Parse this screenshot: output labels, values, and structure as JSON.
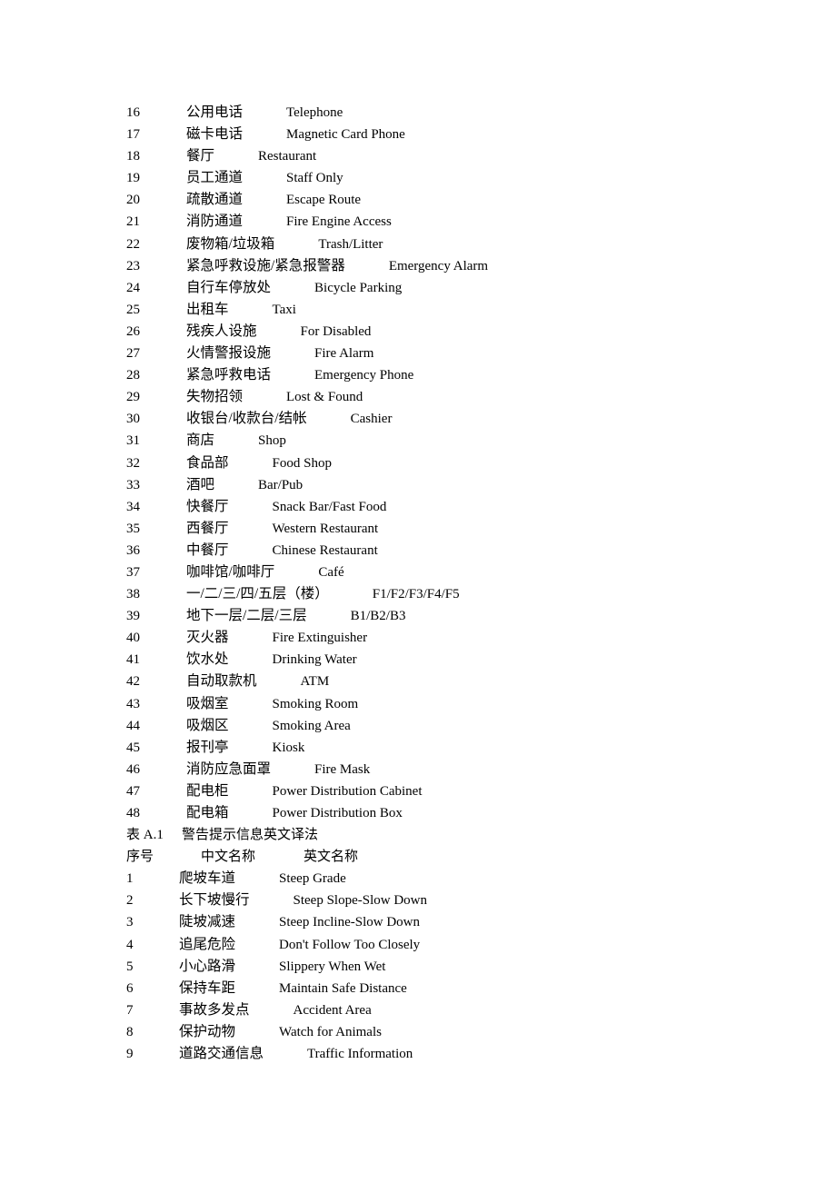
{
  "table_a": {
    "rows": [
      [
        "16",
        "公用电话",
        "Telephone"
      ],
      [
        "17",
        "磁卡电话",
        "Magnetic Card Phone"
      ],
      [
        "18",
        "餐厅",
        "Restaurant"
      ],
      [
        "19",
        "员工通道",
        "Staff Only"
      ],
      [
        "20",
        "疏散通道",
        "Escape Route"
      ],
      [
        "21",
        "消防通道",
        "Fire Engine Access"
      ],
      [
        "22",
        "废物箱/垃圾箱",
        "Trash/Litter"
      ],
      [
        "23",
        "紧急呼救设施/紧急报警器",
        "Emergency Alarm"
      ],
      [
        "24",
        "自行车停放处",
        "Bicycle Parking"
      ],
      [
        "25",
        "出租车",
        "Taxi"
      ],
      [
        "26",
        "残疾人设施",
        "For Disabled"
      ],
      [
        "27",
        "火情警报设施",
        "Fire Alarm"
      ],
      [
        "28",
        "紧急呼救电话",
        "Emergency Phone"
      ],
      [
        "29",
        "失物招领",
        "Lost & Found"
      ],
      [
        "30",
        "收银台/收款台/结帐",
        "Cashier"
      ],
      [
        "31",
        "商店",
        "Shop"
      ],
      [
        "32",
        "食品部",
        "Food Shop"
      ],
      [
        "33",
        "酒吧",
        "Bar/Pub"
      ],
      [
        "34",
        "快餐厅",
        "Snack Bar/Fast Food"
      ],
      [
        "35",
        "西餐厅",
        "Western Restaurant"
      ],
      [
        "36",
        "中餐厅",
        "Chinese Restaurant"
      ],
      [
        "37",
        "咖啡馆/咖啡厅",
        "Café"
      ],
      [
        "38",
        "一/二/三/四/五层（楼）",
        "F1/F2/F3/F4/F5"
      ],
      [
        "39",
        "地下一层/二层/三层",
        "B1/B2/B3"
      ],
      [
        "40",
        "灭火器",
        "Fire Extinguisher"
      ],
      [
        "41",
        "饮水处",
        "Drinking Water"
      ],
      [
        "42",
        "自动取款机",
        "ATM"
      ],
      [
        "43",
        "吸烟室",
        "Smoking Room"
      ],
      [
        "44",
        "吸烟区",
        "Smoking Area"
      ],
      [
        "45",
        "报刊亭",
        "Kiosk"
      ],
      [
        "46",
        "消防应急面罩",
        "Fire Mask"
      ],
      [
        "47",
        "配电柜",
        "Power Distribution Cabinet"
      ],
      [
        "48",
        "配电箱",
        "Power Distribution Box"
      ]
    ]
  },
  "table_b": {
    "caption_label": "表 A.1",
    "caption_title": "警告提示信息英文译法",
    "headers": [
      "序号",
      "中文名称",
      "英文名称"
    ],
    "rows": [
      [
        "1",
        "爬坡车道",
        "Steep Grade"
      ],
      [
        "2",
        "长下坡慢行",
        "Steep Slope-Slow Down"
      ],
      [
        "3",
        "陡坡减速",
        "Steep Incline-Slow Down"
      ],
      [
        "4",
        "追尾危险",
        "Don't Follow Too Closely"
      ],
      [
        "5",
        "小心路滑",
        "Slippery When Wet"
      ],
      [
        "6",
        "保持车距",
        "Maintain Safe Distance"
      ],
      [
        "7",
        "事故多发点",
        "Accident Area"
      ],
      [
        "8",
        "保护动物",
        "Watch for Animals"
      ],
      [
        "9",
        "道路交通信息",
        "Traffic Information"
      ]
    ]
  }
}
